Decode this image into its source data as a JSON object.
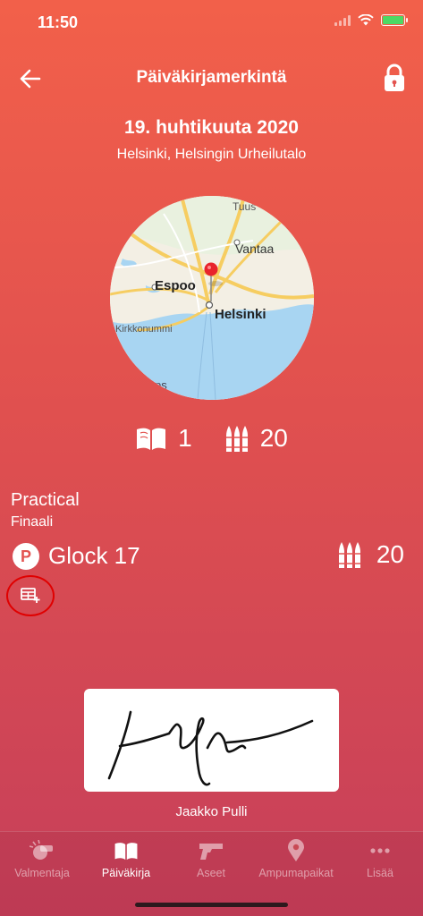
{
  "status": {
    "time": "11:50"
  },
  "header": {
    "title": "Päiväkirjamerkintä"
  },
  "entry": {
    "date": "19. huhtikuuta 2020",
    "location": "Helsinki, Helsingin Urheilutalo"
  },
  "map": {
    "labels": {
      "tuusula": "Tuus",
      "vantaa": "Vantaa",
      "espoo": "Espoo",
      "helsinki": "Helsinki",
      "kirkkonummi": "Kirkkonummi",
      "ps": "ps"
    }
  },
  "stats": {
    "sessions": "1",
    "rounds": "20"
  },
  "series": {
    "discipline": "Practical",
    "subtitle": "Finaali",
    "badge": "P",
    "weapon": "Glock 17",
    "rounds": "20"
  },
  "signature": {
    "name": "Jaakko Pulli"
  },
  "tabs": [
    {
      "label": "Valmentaja",
      "icon": "whistle-icon"
    },
    {
      "label": "Päiväkirja",
      "icon": "book-icon"
    },
    {
      "label": "Aseet",
      "icon": "gun-icon"
    },
    {
      "label": "Ampumapaikat",
      "icon": "map-pin-icon"
    },
    {
      "label": "Lisää",
      "icon": "more-icon"
    }
  ],
  "colors": {
    "accent": "#e35450",
    "highlight_ring": "#e00000",
    "battery": "#4cd964"
  }
}
